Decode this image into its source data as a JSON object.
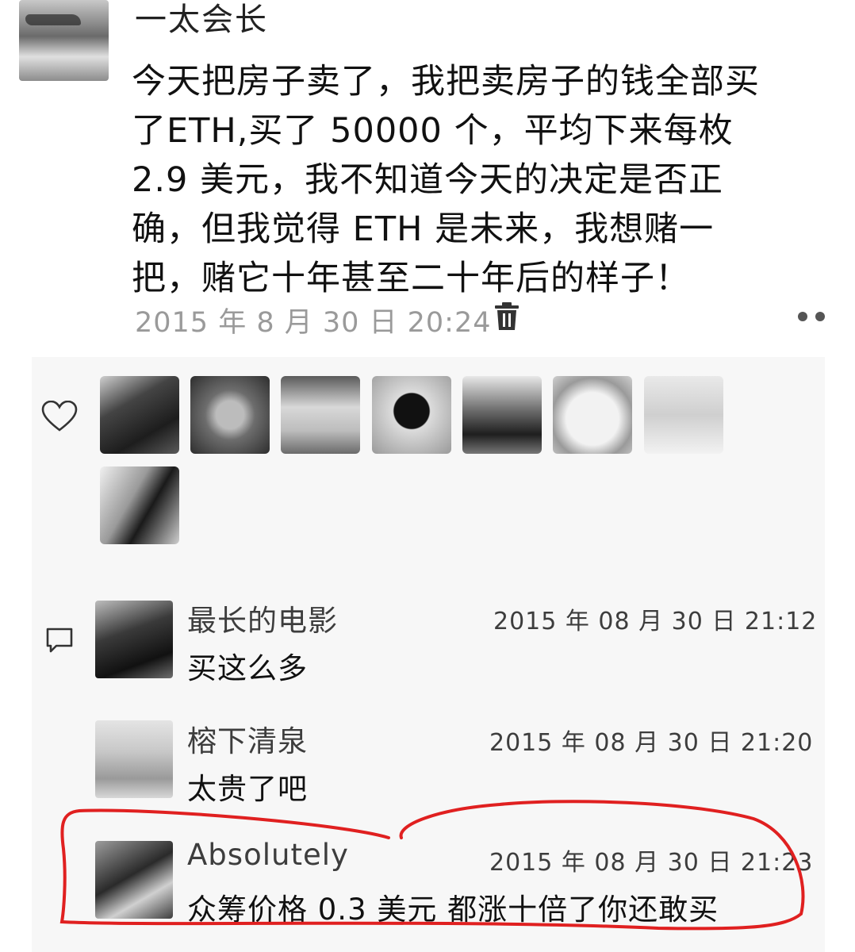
{
  "post": {
    "author": "一太会长",
    "text": "今天把房子卖了，我把卖房子的钱全部买\n了ETH,买了 50000 个，平均下来每枚\n 2.9 美元，我不知道今天的决定是否正\n确，但我觉得 ETH 是未来，我想赌一\n把，赌它十年甚至二十年后的样子！",
    "time": "2015 年 8 月 30 日  20:24"
  },
  "likes": {
    "icon": "heart-icon",
    "avatars": [
      "avatar-1",
      "avatar-2",
      "avatar-3",
      "avatar-4",
      "avatar-5",
      "avatar-6",
      "avatar-7",
      "avatar-8"
    ]
  },
  "comments": [
    {
      "name": "最长的电影",
      "time": "2015 年 08 月 30 日  21:12",
      "text": "买这么多"
    },
    {
      "name": "榕下清泉",
      "time": "2015 年 08 月 30 日  21:20",
      "text": "太贵了吧"
    },
    {
      "name": "Absolutely",
      "time": "2015 年 08 月 30 日  21:23",
      "text": "众筹价格 0.3 美元 都涨十倍了你还敢买"
    }
  ],
  "colors": {
    "highlight": "#e02020",
    "panel": "#f7f7f7",
    "time_gray": "#9a9a9a"
  }
}
